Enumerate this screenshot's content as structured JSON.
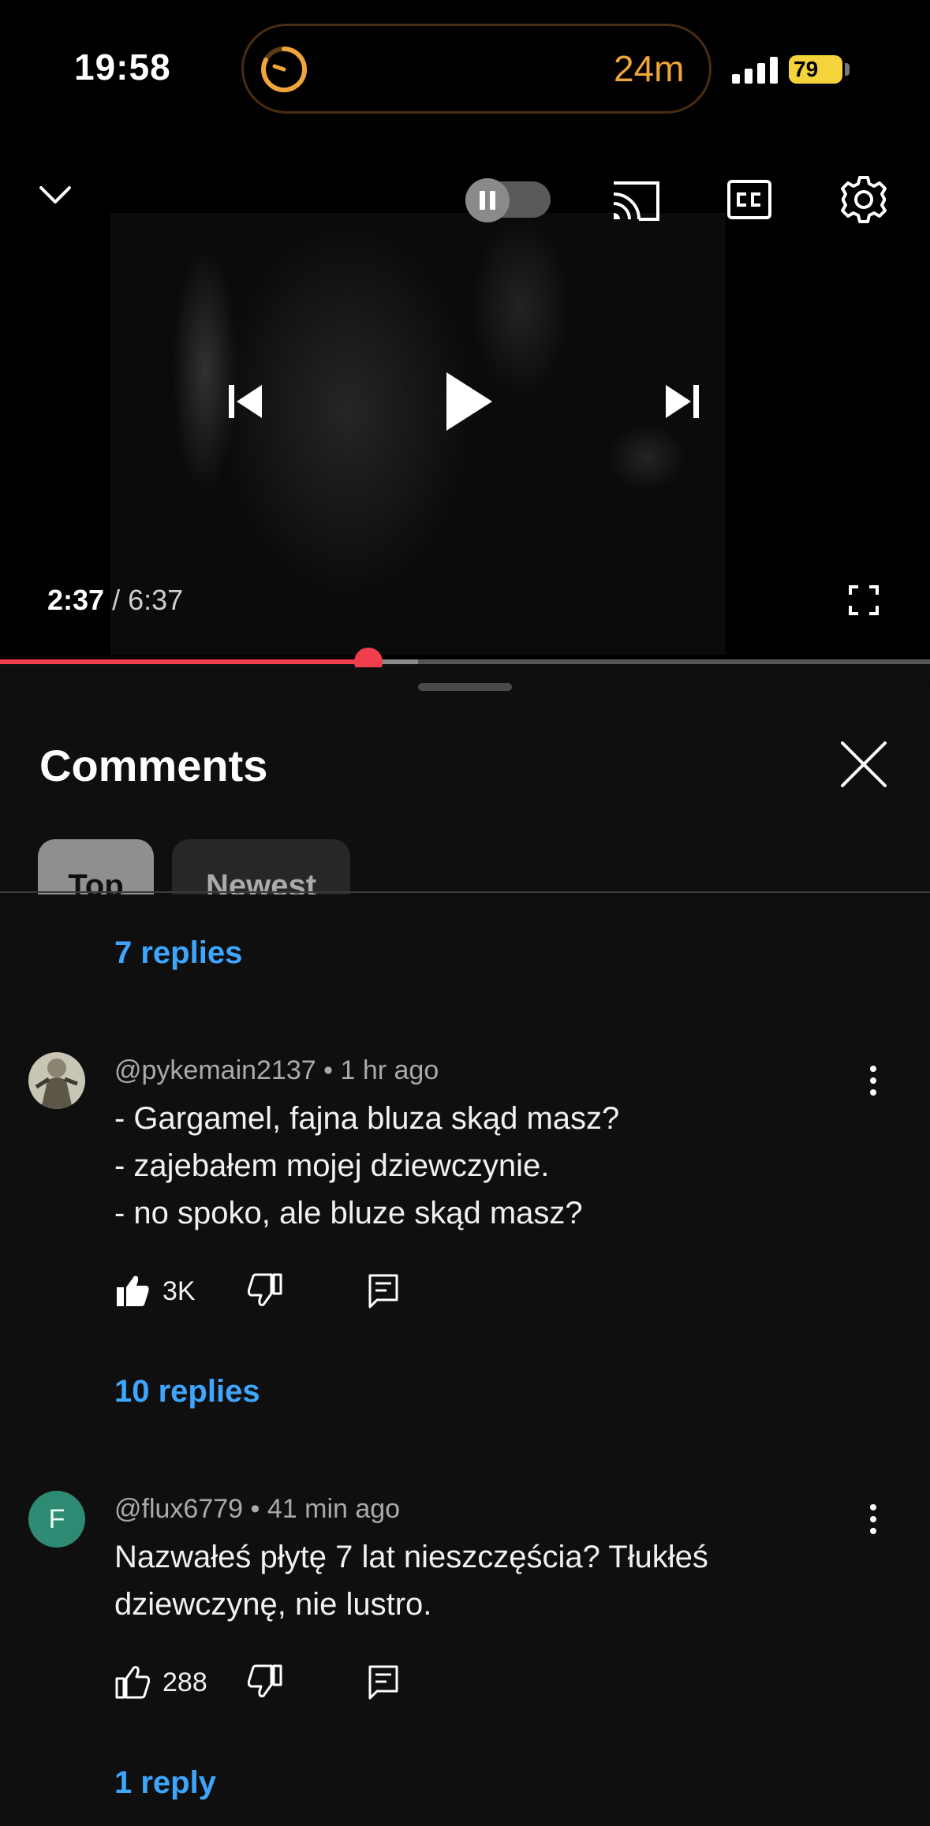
{
  "status_bar": {
    "time": "19:58",
    "live_activity_timer": "24m",
    "battery_percent": "79"
  },
  "player": {
    "current_time": "2:37",
    "separator": " / ",
    "duration": "6:37",
    "progress_fraction": 0.39,
    "icons": [
      "chevron-down-icon",
      "autoplay-toggle",
      "cast-icon",
      "captions-icon",
      "settings-gear-icon",
      "previous-icon",
      "play-icon",
      "next-icon",
      "fullscreen-icon"
    ]
  },
  "comments_sheet": {
    "title": "Comments",
    "tabs": [
      {
        "label": "Top",
        "selected": true
      },
      {
        "label": "Newest",
        "selected": false
      }
    ],
    "top_replies_label": "7 replies",
    "comments": [
      {
        "author": "@pykemain2137",
        "meta": "• 1 hr ago",
        "text": "- Gargamel, fajna bluza skąd masz?\n- zajebałem mojej dziewczynie.\n- no spoko, ale bluze skąd masz?",
        "likes": "3K",
        "liked": true,
        "replies_label": "10 replies"
      },
      {
        "author": "@flux6779",
        "meta": "• 41 min ago",
        "avatar_letter": "F",
        "text": "Nazwałeś płytę 7 lat nieszczęścia? Tłukłeś dziewczynę, nie lustro.",
        "likes": "288",
        "liked": false,
        "replies_label": "1 reply"
      }
    ]
  },
  "colors": {
    "accent_red": "#f03e4c",
    "link_blue": "#3ea6ff",
    "timer_orange": "#f0a53a",
    "battery_yellow": "#f5d33c"
  }
}
